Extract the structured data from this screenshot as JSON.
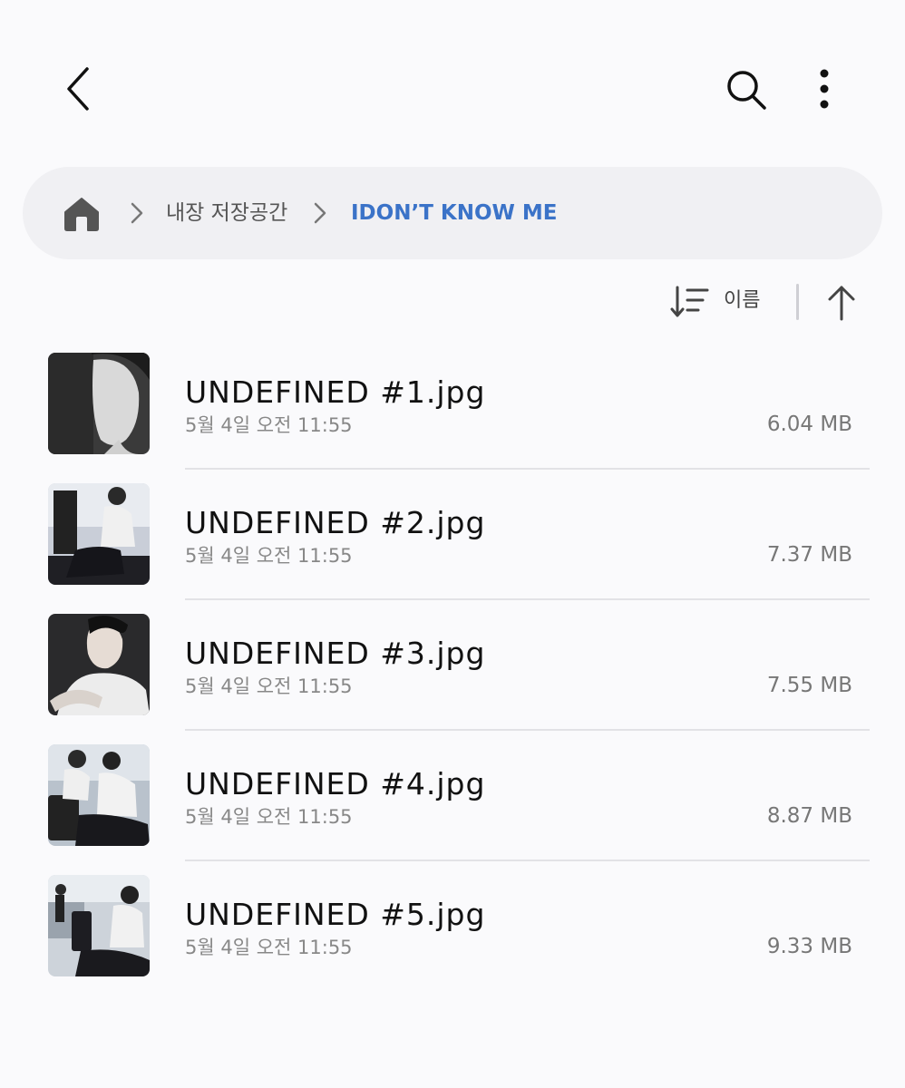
{
  "toolbar": {
    "back_icon": "chevron-left-icon",
    "search_icon": "search-icon",
    "more_icon": "more-vertical-icon"
  },
  "breadcrumb": {
    "home_icon": "home-icon",
    "items": [
      {
        "label": "내장 저장공간"
      },
      {
        "label": "IDON’T KNOW ME"
      }
    ],
    "current_color": "#3b73c8"
  },
  "sort": {
    "icon": "sort-icon",
    "label": "이름",
    "direction_icon": "arrow-up-icon"
  },
  "files": [
    {
      "name": "UNDEFINED #1.jpg",
      "date": "5월 4일 오전 11:55",
      "size": "6.04 MB"
    },
    {
      "name": "UNDEFINED #2.jpg",
      "date": "5월 4일 오전 11:55",
      "size": "7.37 MB"
    },
    {
      "name": "UNDEFINED #3.jpg",
      "date": "5월 4일 오전 11:55",
      "size": "7.55 MB"
    },
    {
      "name": "UNDEFINED #4.jpg",
      "date": "5월 4일 오전 11:55",
      "size": "8.87 MB"
    },
    {
      "name": "UNDEFINED #5.jpg",
      "date": "5월 4일 오전 11:55",
      "size": "9.33 MB"
    }
  ],
  "colors": {
    "background": "#fafafc",
    "breadcrumb_bg": "#f0f0f3",
    "accent": "#3b73c8"
  }
}
